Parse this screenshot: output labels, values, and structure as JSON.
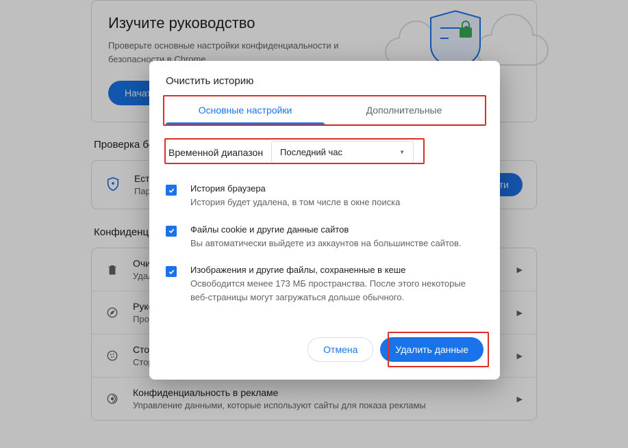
{
  "guide": {
    "title": "Изучите руководство",
    "description": "Проверьте основные настройки конфиденциальности и безопасности в Chrome.",
    "start_label": "Начать"
  },
  "security_check": {
    "heading": "Проверка безопасности",
    "row_title": "Есть р",
    "row_subtitle": "Парол",
    "btn_suffix": "сности"
  },
  "privacy_heading": "Конфиденциа",
  "privacy_items": [
    {
      "title": "Очист",
      "subtitle": "Удали"
    },
    {
      "title": "Руков",
      "subtitle": "Прове"
    },
    {
      "title": "Сторо",
      "subtitle": "Сторо"
    },
    {
      "title": "Конфиденциальность в рекламе",
      "subtitle": "Управление данными, которые используют сайты для показа рекламы"
    }
  ],
  "dialog": {
    "title": "Очистить историю",
    "tab1": "Основные настройки",
    "tab2": "Дополнительные",
    "time_label": "Временной диапазон",
    "time_value": "Последний час",
    "options": [
      {
        "title": "История браузера",
        "desc": "История будет удалена, в том числе в окне поиска"
      },
      {
        "title": "Файлы cookie и другие данные сайтов",
        "desc": "Вы автоматически выйдете из аккаунтов на большинстве сайтов."
      },
      {
        "title": "Изображения и другие файлы, сохраненные в кеше",
        "desc": "Освободится менее 173 МБ пространства. После этого некоторые веб-страницы могут загружаться дольше обычного."
      }
    ],
    "cancel_label": "Отмена",
    "delete_label": "Удалить данные"
  }
}
